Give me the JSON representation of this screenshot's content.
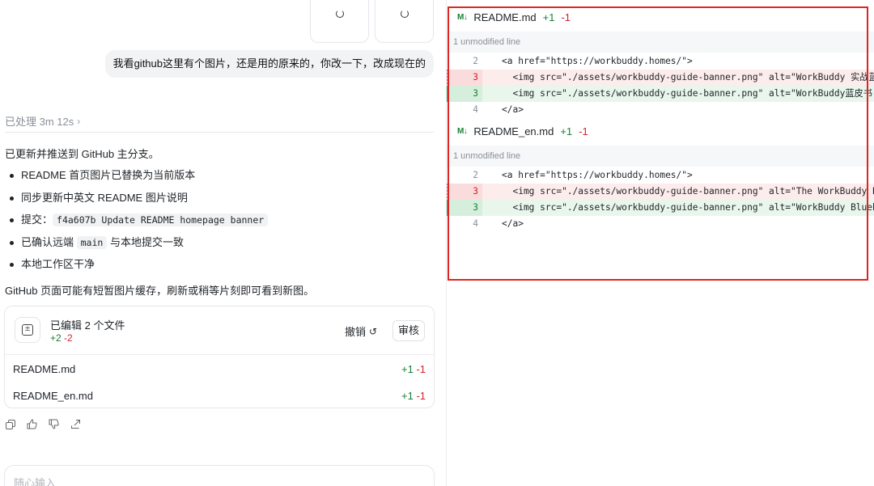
{
  "chat": {
    "user_message": "我看github这里有个图片，还是用的原来的，你改一下，改成现在的",
    "processed_label": "已处理 3m 12s",
    "intro": "已更新并推送到 GitHub 主分支。",
    "bullets": {
      "b1": "README 首页图片已替换为当前版本",
      "b2": "同步更新中英文 README 图片说明",
      "b3_prefix": "提交：",
      "b3_code": "f4a607b Update README homepage banner",
      "b4_prefix": "已确认远端 ",
      "b4_code": "main",
      "b4_suffix": " 与本地提交一致",
      "b5": "本地工作区干净"
    },
    "note": "GitHub 页面可能有短暂图片缓存，刷新或稍等片刻即可看到新图。",
    "edit_card": {
      "title": "已编辑 2 个文件",
      "plus": "+2",
      "minus": "-2",
      "undo_label": "撤销",
      "review_label": "审核",
      "files": [
        {
          "name": "README.md",
          "plus": "+1",
          "minus": "-1"
        },
        {
          "name": "README_en.md",
          "plus": "+1",
          "minus": "-1"
        }
      ]
    },
    "input_placeholder": "随心输入"
  },
  "diff": {
    "files": [
      {
        "name": "README.md",
        "plus": "+1",
        "minus": "-1",
        "unmodified": "1 unmodified line",
        "lines": [
          {
            "num": "2",
            "code": "<a href=\"https://workbuddy.homes/\">"
          },
          {
            "num": "3",
            "code": "  <img src=\"./assets/workbuddy-guide-banner.png\" alt=\"WorkBuddy 实战蓝皮书\" />"
          },
          {
            "num": "3",
            "code": "  <img src=\"./assets/workbuddy-guide-banner.png\" alt=\"WorkBuddy蓝皮书 封面\" />"
          },
          {
            "num": "4",
            "code": "</a>"
          }
        ]
      },
      {
        "name": "README_en.md",
        "plus": "+1",
        "minus": "-1",
        "unmodified": "1 unmodified line",
        "lines": [
          {
            "num": "2",
            "code": "<a href=\"https://workbuddy.homes/\">"
          },
          {
            "num": "3",
            "code": "  <img src=\"./assets/workbuddy-guide-banner.png\" alt=\"The WorkBuddy Blue Book\" />"
          },
          {
            "num": "3",
            "code": "  <img src=\"./assets/workbuddy-guide-banner.png\" alt=\"WorkBuddy Bluebook Cover\" />"
          },
          {
            "num": "4",
            "code": "</a>"
          }
        ]
      }
    ]
  },
  "colors": {
    "added": "#1a7f37",
    "removed": "#cf222e",
    "highlight_border": "#e02424"
  }
}
